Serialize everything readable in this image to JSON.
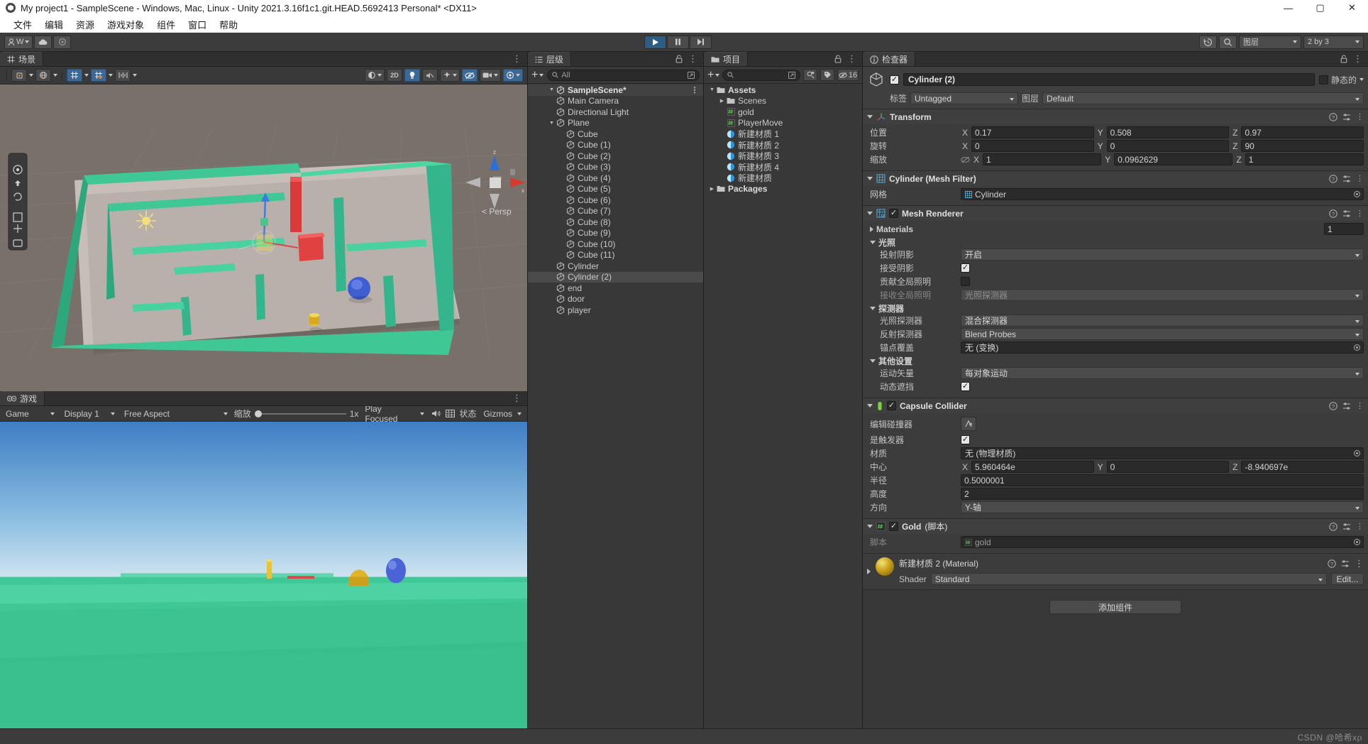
{
  "titlebar": {
    "title": "My project1 - SampleScene - Windows, Mac, Linux - Unity 2021.3.16f1c1.git.HEAD.5692413 Personal* <DX11>",
    "minimize": "—",
    "maximize": "▢",
    "close": "✕"
  },
  "menubar": {
    "items": [
      {
        "label": "文件"
      },
      {
        "label": "编辑"
      },
      {
        "label": "资源"
      },
      {
        "label": "游戏对象"
      },
      {
        "label": "组件"
      },
      {
        "label": "窗口"
      },
      {
        "label": "帮助"
      }
    ]
  },
  "toolbar": {
    "account_label": "W",
    "cloud_icon": "cloud-icon",
    "settings_icon": "gear-icon",
    "play": "▶",
    "pause": "❚❚",
    "step": "▶❙",
    "history_icon": "history-icon",
    "search_icon": "search-icon",
    "layers_label": "图层",
    "layout_label": "2 by 3"
  },
  "scene_panel": {
    "tab_label": "场景",
    "kebab": "⋮",
    "tools": [
      {
        "name": "render-mode",
        "label": "着色"
      },
      {
        "name": "draw-mode",
        "label": "2D"
      },
      {
        "name": "lighting-toggle",
        "label": "💡"
      },
      {
        "name": "audio-toggle",
        "label": "🔈"
      },
      {
        "name": "effects-toggle",
        "label": "✦"
      },
      {
        "name": "hidden-objects-toggle",
        "label": "👁"
      },
      {
        "name": "camera-settings",
        "label": "▣"
      },
      {
        "name": "gizmos-toggle",
        "label": "◍"
      }
    ],
    "gizmo_axis_z": "z",
    "gizmo_axis_x": "x",
    "persp_label": "< Persp"
  },
  "game_panel": {
    "tab_label": "游戏",
    "kebab": "⋮",
    "target_display_value": "Game",
    "display_value": "Display 1",
    "aspect_value": "Free Aspect",
    "scale_label": "缩放",
    "scale_value": "1x",
    "play_focused_value": "Play Focused",
    "mute_icon": "speaker-icon",
    "stats_icon": "stats-icon",
    "stats_label": "状态",
    "gizmos_label": "Gizmos"
  },
  "hierarchy": {
    "tab_label": "层级",
    "lock_icon": "lock-icon",
    "kebab": "⋮",
    "add_label": "+",
    "search_placeholder": "All",
    "scene_name": "SampleScene*",
    "items": [
      {
        "label": "Main Camera",
        "depth": 1,
        "expandable": false,
        "selected": false
      },
      {
        "label": "Directional Light",
        "depth": 1,
        "expandable": false,
        "selected": false
      },
      {
        "label": "Plane",
        "depth": 1,
        "expandable": true,
        "selected": false
      },
      {
        "label": "Cube",
        "depth": 2,
        "expandable": false,
        "selected": false
      },
      {
        "label": "Cube (1)",
        "depth": 2,
        "expandable": false,
        "selected": false
      },
      {
        "label": "Cube (2)",
        "depth": 2,
        "expandable": false,
        "selected": false
      },
      {
        "label": "Cube (3)",
        "depth": 2,
        "expandable": false,
        "selected": false
      },
      {
        "label": "Cube (4)",
        "depth": 2,
        "expandable": false,
        "selected": false
      },
      {
        "label": "Cube (5)",
        "depth": 2,
        "expandable": false,
        "selected": false
      },
      {
        "label": "Cube (6)",
        "depth": 2,
        "expandable": false,
        "selected": false
      },
      {
        "label": "Cube (7)",
        "depth": 2,
        "expandable": false,
        "selected": false
      },
      {
        "label": "Cube (8)",
        "depth": 2,
        "expandable": false,
        "selected": false
      },
      {
        "label": "Cube (9)",
        "depth": 2,
        "expandable": false,
        "selected": false
      },
      {
        "label": "Cube (10)",
        "depth": 2,
        "expandable": false,
        "selected": false
      },
      {
        "label": "Cube (11)",
        "depth": 2,
        "expandable": false,
        "selected": false
      },
      {
        "label": "Cylinder",
        "depth": 1,
        "expandable": false,
        "selected": false
      },
      {
        "label": "Cylinder (2)",
        "depth": 1,
        "expandable": false,
        "selected": true
      },
      {
        "label": "end",
        "depth": 1,
        "expandable": false,
        "selected": false
      },
      {
        "label": "door",
        "depth": 1,
        "expandable": false,
        "selected": false
      },
      {
        "label": "player",
        "depth": 1,
        "expandable": false,
        "selected": false
      }
    ]
  },
  "project": {
    "tab_label": "项目",
    "lock_icon": "lock-icon",
    "kebab": "⋮",
    "add_label": "+",
    "search_placeholder": "",
    "save_icon": "save-search-icon",
    "label_icon": "label-icon",
    "hidden_count": "16",
    "items": [
      {
        "label": "Assets",
        "depth": 0,
        "type": "folder",
        "expanded": true
      },
      {
        "label": "Scenes",
        "depth": 1,
        "type": "folder",
        "expanded": false
      },
      {
        "label": "gold",
        "depth": 1,
        "type": "script"
      },
      {
        "label": "PlayerMove",
        "depth": 1,
        "type": "script"
      },
      {
        "label": "新建材质 1",
        "depth": 1,
        "type": "material"
      },
      {
        "label": "新建材质 2",
        "depth": 1,
        "type": "material"
      },
      {
        "label": "新建材质 3",
        "depth": 1,
        "type": "material"
      },
      {
        "label": "新建材质 4",
        "depth": 1,
        "type": "material"
      },
      {
        "label": "新建材质",
        "depth": 1,
        "type": "material"
      },
      {
        "label": "Packages",
        "depth": 0,
        "type": "folder",
        "expanded": false
      }
    ]
  },
  "inspector": {
    "tab_label": "检查器",
    "lock_icon": "lock-icon",
    "kebab": "⋮",
    "object_name": "Cylinder (2)",
    "static_label": "静态的",
    "tag_label": "标签",
    "tag_value": "Untagged",
    "layer_label": "图层",
    "layer_value": "Default",
    "transform": {
      "title": "Transform",
      "position_label": "位置",
      "position": {
        "x": "0.17",
        "y": "0.508",
        "z": "0.97"
      },
      "rotation_label": "旋转",
      "rotation": {
        "x": "0",
        "y": "0",
        "z": "90"
      },
      "scale_label": "缩放",
      "scale": {
        "x": "1",
        "y": "0.0962629",
        "z": "1"
      }
    },
    "mesh_filter": {
      "title": "Cylinder (Mesh Filter)",
      "mesh_label": "网格",
      "mesh_value": "Cylinder"
    },
    "mesh_renderer": {
      "title": "Mesh Renderer",
      "materials_label": "Materials",
      "materials_count": "1",
      "lighting_label": "光照",
      "cast_shadows_label": "投射阴影",
      "cast_shadows_value": "开启",
      "receive_shadows_label": "接受阴影",
      "receive_shadows_checked": true,
      "contribute_gi_label": "贡献全局照明",
      "contribute_gi_checked": false,
      "receive_gi_label": "接收全局照明",
      "receive_gi_value": "光照探测器",
      "probes_label": "探测器",
      "light_probes_label": "光照探测器",
      "light_probes_value": "混合探测器",
      "reflection_probes_label": "反射探测器",
      "reflection_probes_value": "Blend Probes",
      "anchor_override_label": "锚点覆盖",
      "anchor_override_value": "无 (变换)",
      "additional_label": "其他设置",
      "motion_vectors_label": "运动矢量",
      "motion_vectors_value": "每对象运动",
      "dynamic_occlusion_label": "动态遮挡",
      "dynamic_occlusion_checked": true
    },
    "capsule_collider": {
      "title": "Capsule Collider",
      "edit_collider_label": "编辑碰撞器",
      "is_trigger_label": "是触发器",
      "is_trigger_checked": true,
      "material_label": "材质",
      "material_value": "无 (物理材质)",
      "center_label": "中心",
      "center": {
        "x": "5.960464e",
        "y": "0",
        "z": "-8.940697e"
      },
      "radius_label": "半径",
      "radius_value": "0.5000001",
      "height_label": "高度",
      "height_value": "2",
      "direction_label": "方向",
      "direction_value": "Y-轴"
    },
    "gold_script": {
      "title": "Gold",
      "title_suffix": "(脚本)",
      "script_label": "脚本",
      "script_value": "gold"
    },
    "material_preview": {
      "title": "新建材质 2 (Material)",
      "shader_label": "Shader",
      "shader_value": "Standard",
      "edit_label": "Edit..."
    },
    "add_component_label": "添加组件"
  },
  "statusbar": {
    "watermark": "CSDN @哈希xρ"
  },
  "colors": {
    "accent_blue": "#3b6896",
    "maze_green": "#3fc795",
    "scene_bg": "#787069",
    "panel_bg": "#383838",
    "header_bg": "#3f3f3f",
    "sky_top": "#3f7ec4",
    "sky_bottom": "#c6dcee",
    "ground_green": "#3fc795",
    "gold_yellow": "#d4a017",
    "player_blue": "#3f5fd0",
    "red_marker": "#e03030"
  }
}
